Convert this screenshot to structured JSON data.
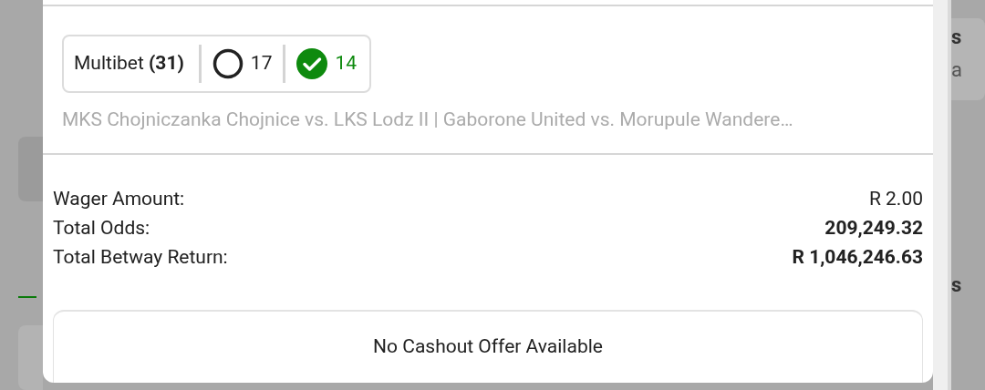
{
  "bet_card": {
    "bet_type": "Multibet **(31)**",
    "counters": [
      {
        "kind": "open",
        "value": "17"
      },
      {
        "kind": "won",
        "value": "14"
      }
    ],
    "matches": "MKS Chojniczanka Chojnice vs. LKS Lodz II | Gaborone United vs. Morupule Wandere…"
  },
  "summary": [
    {
      "label": "Wager Amount:",
      "value": "R 2.00",
      "bold": false
    },
    {
      "label": "Total Odds:",
      "value": "209,249.32",
      "bold": true
    },
    {
      "label": "Total Betway Return:",
      "value": "R 1,046,246.63",
      "bold": true
    }
  ],
  "cashout": {
    "label": "No Cashout Offer Available"
  },
  "background_fragments": [
    {
      "text": "s",
      "bold": true
    },
    {
      "text": "a",
      "bold": false
    },
    {
      "text": "s",
      "bold": true
    }
  ]
}
